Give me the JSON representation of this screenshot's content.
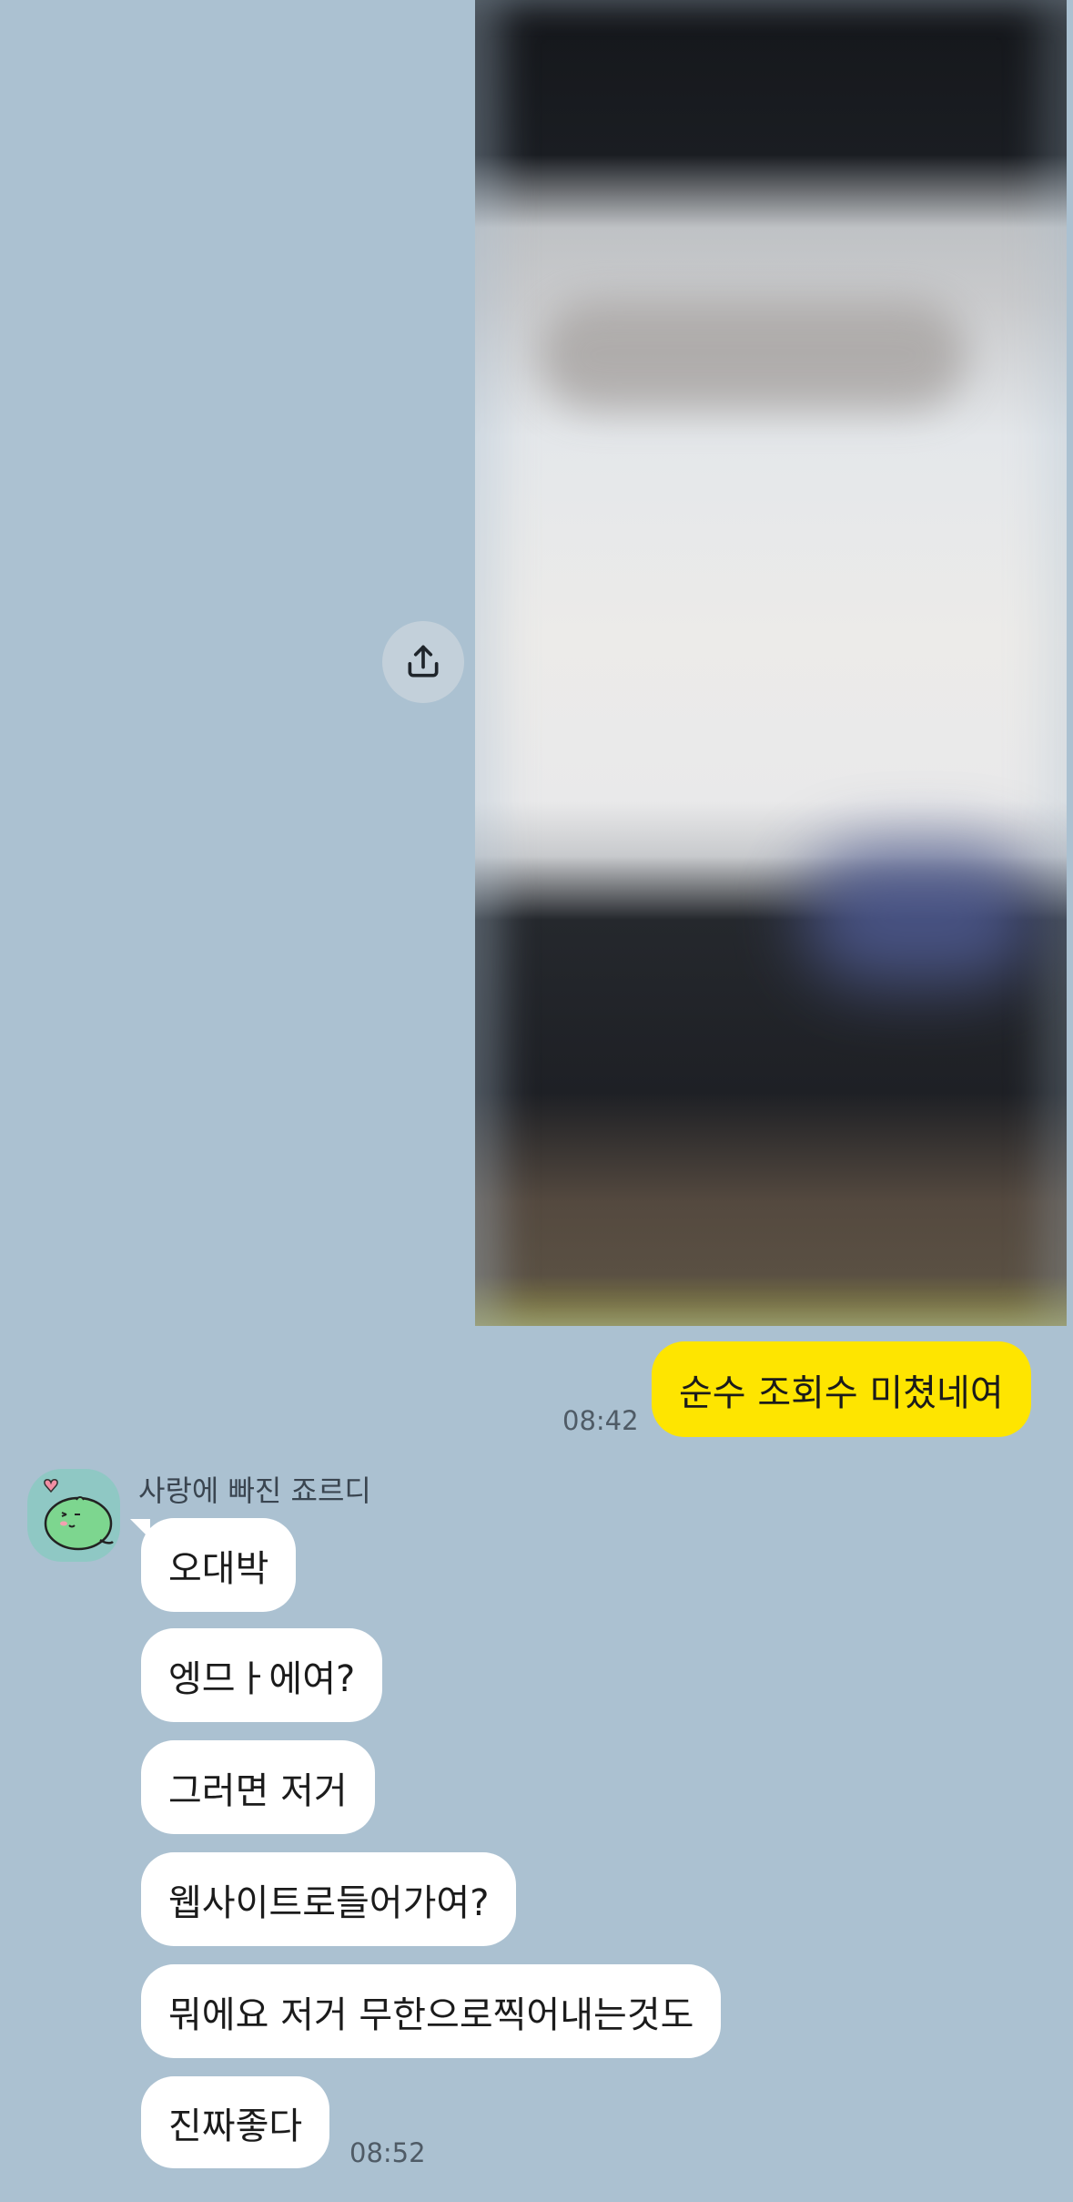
{
  "outgoing": {
    "image": "blurred-photo",
    "text": "순수 조회수 미쳤네여",
    "time": "08:42",
    "bubble_color": "#fee500"
  },
  "share_icon": "share-upload-icon",
  "incoming": {
    "sender_name": "사랑에 빠진 죠르디",
    "avatar": "green-dinosaur-with-heart",
    "messages": [
      "오대박",
      "엥므ㅏ에여?",
      "그러면 저거",
      "웹사이트로들어가여?",
      "뭐에요 저거 무한으로찍어내는것도",
      "진짜좋다"
    ],
    "time": "08:52"
  },
  "colors": {
    "background": "#abc1d1",
    "incoming_bubble": "#ffffff"
  }
}
